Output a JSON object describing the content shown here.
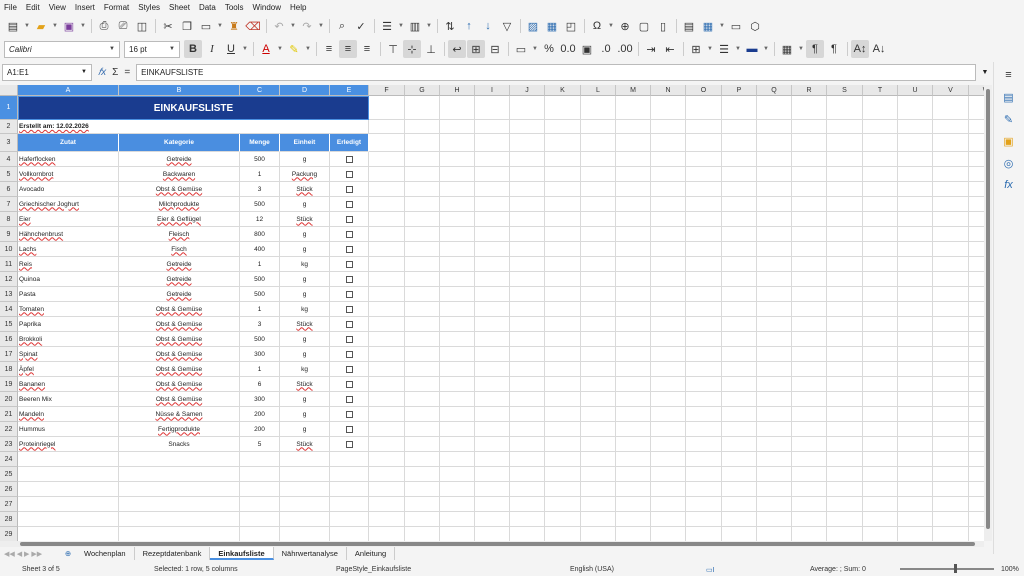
{
  "menu": [
    "File",
    "Edit",
    "View",
    "Insert",
    "Format",
    "Styles",
    "Sheet",
    "Data",
    "Tools",
    "Window",
    "Help"
  ],
  "toolbar": {
    "font_name": "Calibri",
    "font_size": "16 pt"
  },
  "formula_bar": {
    "cell_ref": "A1:E1",
    "sum_symbol": "Σ",
    "equals_symbol": "=",
    "content": "EINKAUFSLISTE"
  },
  "columns": [
    "A",
    "B",
    "C",
    "D",
    "E",
    "F",
    "G",
    "H",
    "I",
    "J",
    "K",
    "L",
    "M",
    "N",
    "O",
    "P",
    "Q",
    "R",
    "S",
    "T",
    "U",
    "V",
    "W",
    "X"
  ],
  "rows": [
    "1",
    "2",
    "3",
    "4",
    "5",
    "6",
    "7",
    "8",
    "9",
    "10",
    "11",
    "12",
    "13",
    "14",
    "15",
    "16",
    "17",
    "18",
    "19",
    "20",
    "21",
    "22",
    "23",
    "24",
    "25",
    "26",
    "27",
    "28",
    "29",
    "30"
  ],
  "sheet": {
    "title": "EINKAUFSLISTE",
    "created": "Erstellt am: 12.02.2026",
    "headers": [
      "Zutat",
      "Kategorie",
      "Menge",
      "Einheit",
      "Erledigt"
    ],
    "items": [
      {
        "zutat": "Haferflocken",
        "kategorie": "Getreide",
        "menge": "500",
        "einheit": "g"
      },
      {
        "zutat": "Vollkornbrot",
        "kategorie": "Backwaren",
        "menge": "1",
        "einheit": "Packung"
      },
      {
        "zutat": "Avocado",
        "kategorie": "Obst & Gemüse",
        "menge": "3",
        "einheit": "Stück"
      },
      {
        "zutat": "Griechischer Joghurt",
        "kategorie": "Milchprodukte",
        "menge": "500",
        "einheit": "g"
      },
      {
        "zutat": "Eier",
        "kategorie": "Eier & Geflügel",
        "menge": "12",
        "einheit": "Stück"
      },
      {
        "zutat": "Hähnchenbrust",
        "kategorie": "Fleisch",
        "menge": "800",
        "einheit": "g"
      },
      {
        "zutat": "Lachs",
        "kategorie": "Fisch",
        "menge": "400",
        "einheit": "g"
      },
      {
        "zutat": "Reis",
        "kategorie": "Getreide",
        "menge": "1",
        "einheit": "kg"
      },
      {
        "zutat": "Quinoa",
        "kategorie": "Getreide",
        "menge": "500",
        "einheit": "g"
      },
      {
        "zutat": "Pasta",
        "kategorie": "Getreide",
        "menge": "500",
        "einheit": "g"
      },
      {
        "zutat": "Tomaten",
        "kategorie": "Obst & Gemüse",
        "menge": "1",
        "einheit": "kg"
      },
      {
        "zutat": "Paprika",
        "kategorie": "Obst & Gemüse",
        "menge": "3",
        "einheit": "Stück"
      },
      {
        "zutat": "Brokkoli",
        "kategorie": "Obst & Gemüse",
        "menge": "500",
        "einheit": "g"
      },
      {
        "zutat": "Spinat",
        "kategorie": "Obst & Gemüse",
        "menge": "300",
        "einheit": "g"
      },
      {
        "zutat": "Äpfel",
        "kategorie": "Obst & Gemüse",
        "menge": "1",
        "einheit": "kg"
      },
      {
        "zutat": "Bananen",
        "kategorie": "Obst & Gemüse",
        "menge": "6",
        "einheit": "Stück"
      },
      {
        "zutat": "Beeren Mix",
        "kategorie": "Obst & Gemüse",
        "menge": "300",
        "einheit": "g"
      },
      {
        "zutat": "Mandeln",
        "kategorie": "Nüsse & Samen",
        "menge": "200",
        "einheit": "g"
      },
      {
        "zutat": "Hummus",
        "kategorie": "Fertigprodukte",
        "menge": "200",
        "einheit": "g"
      },
      {
        "zutat": "Proteinriegel",
        "kategorie": "Snacks",
        "menge": "5",
        "einheit": "Stück"
      }
    ]
  },
  "tabs": [
    "Wochenplan",
    "Rezeptdatenbank",
    "Einkaufsliste",
    "Nährwertanalyse",
    "Anleitung"
  ],
  "status": {
    "sheet": "Sheet 3 of 5",
    "selection": "Selected: 1 row, 5 columns",
    "page_style": "PageStyle_Einkaufsliste",
    "language": "English (USA)",
    "stats": "Average: ; Sum: 0",
    "zoom": "100%"
  }
}
